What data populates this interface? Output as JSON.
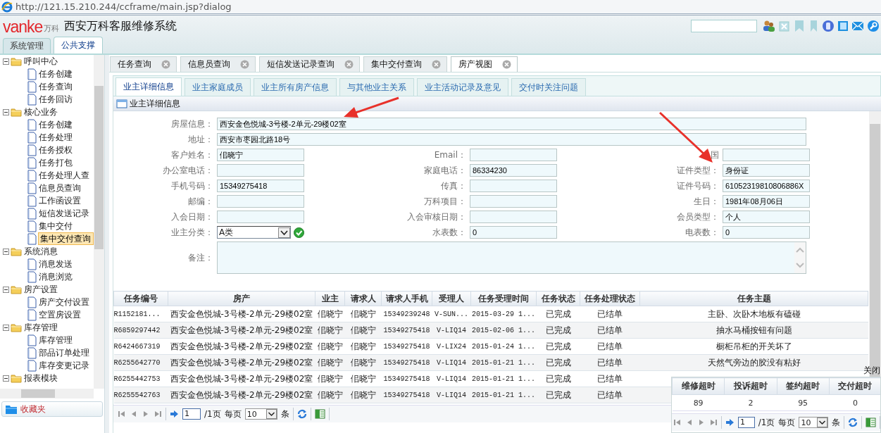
{
  "browser": {
    "url": "http://121.15.210.244/ccframe/main.jsp?dialog"
  },
  "header": {
    "logo": "vanke",
    "logo_cn": "万科",
    "title": "西安万科客服维修系统"
  },
  "module_tabs": [
    {
      "label": "系统管理",
      "selected": false
    },
    {
      "label": "公共支撑",
      "selected": true
    }
  ],
  "sidebar": {
    "tree": [
      {
        "label": "呼叫中心",
        "expanded": true,
        "children": [
          {
            "label": "任务创建",
            "selected": false
          },
          {
            "label": "任务查询",
            "selected": false
          },
          {
            "label": "任务回访",
            "selected": false
          }
        ]
      },
      {
        "label": "核心业务",
        "expanded": true,
        "children": [
          {
            "label": "任务创建",
            "selected": false
          },
          {
            "label": "任务处理",
            "selected": false
          },
          {
            "label": "任务授权",
            "selected": false
          },
          {
            "label": "任务打包",
            "selected": false
          },
          {
            "label": "任务处理人查",
            "selected": false
          },
          {
            "label": "信息员查询",
            "selected": false
          },
          {
            "label": "工作函设置",
            "selected": false
          },
          {
            "label": "短信发送记录",
            "selected": false
          },
          {
            "label": "集中交付",
            "selected": false
          },
          {
            "label": "集中交付查询",
            "selected": true
          }
        ]
      },
      {
        "label": "系统消息",
        "expanded": true,
        "children": [
          {
            "label": "消息发送",
            "selected": false
          },
          {
            "label": "消息浏览",
            "selected": false
          }
        ]
      },
      {
        "label": "房产设置",
        "expanded": true,
        "children": [
          {
            "label": "房产交付设置",
            "selected": false
          },
          {
            "label": "空置房设置",
            "selected": false
          }
        ]
      },
      {
        "label": "库存管理",
        "expanded": true,
        "children": [
          {
            "label": "库存管理",
            "selected": false
          },
          {
            "label": "部品订单处理",
            "selected": false
          },
          {
            "label": "库存变更记录",
            "selected": false
          }
        ]
      },
      {
        "label": "报表模块",
        "expanded": true
      }
    ],
    "favorites": "收藏夹"
  },
  "doc_tabs": [
    {
      "label": "任务查询",
      "selected": false
    },
    {
      "label": "信息员查询",
      "selected": false
    },
    {
      "label": "短信发送记录查询",
      "selected": false
    },
    {
      "label": "集中交付查询",
      "selected": false
    },
    {
      "label": "房产视图",
      "selected": true
    }
  ],
  "sub_tabs": [
    {
      "label": "业主详细信息",
      "selected": true
    },
    {
      "label": "业主家庭成员",
      "selected": false
    },
    {
      "label": "业主所有房产信息",
      "selected": false
    },
    {
      "label": "与其他业主关系",
      "selected": false
    },
    {
      "label": "业主活动记录及意见",
      "selected": false
    },
    {
      "label": "交付时关注问题",
      "selected": false
    }
  ],
  "panel": {
    "title": "业主详细信息",
    "wide_fields": [
      {
        "label": "房屋信息：",
        "value": "西安金色悦城-3号楼-2单元-29楼02室"
      },
      {
        "label": "地址：",
        "value": "西安市枣园北路18号"
      }
    ],
    "fields": [
      {
        "kind": "text",
        "label": "客户姓名：",
        "value": "佀晓宁"
      },
      {
        "kind": "text",
        "label": "Email："
      },
      {
        "kind": "text",
        "label": "国"
      },
      {
        "kind": "text",
        "label": "办公室电话："
      },
      {
        "kind": "text",
        "label": "家庭电话：",
        "value": "86334230"
      },
      {
        "kind": "text",
        "label": "证件类型：",
        "value": "身份证"
      },
      {
        "kind": "text",
        "label": "手机号码：",
        "value": "15349275418"
      },
      {
        "kind": "text",
        "label": "传真："
      },
      {
        "kind": "text",
        "label": "证件号码：",
        "value": "61052319810806886X"
      },
      {
        "kind": "text",
        "label": "邮编："
      },
      {
        "kind": "text",
        "label": "万科项目："
      },
      {
        "kind": "text",
        "label": "生日：",
        "value": "1981年08月06日"
      },
      {
        "kind": "text",
        "label": "入会日期："
      },
      {
        "kind": "text",
        "label": "入会审核日期："
      },
      {
        "kind": "text",
        "label": "会员类型：",
        "value": "个人"
      },
      {
        "kind": "select",
        "label": "业主分类：",
        "value": "A类"
      },
      {
        "kind": "text",
        "label": "水表数：",
        "value": "0"
      },
      {
        "kind": "text",
        "label": "电表数：",
        "value": "0"
      }
    ],
    "remark": {
      "label": "备注："
    }
  },
  "table": {
    "columns": [
      "任务编号",
      "房产",
      "业主",
      "请求人",
      "请求人手机",
      "受理人",
      "任务受理时间",
      "任务状态",
      "任务处理状态",
      "任务主题"
    ],
    "rows": [
      [
        "R1152181...",
        "西安金色悦城-3号楼-2单元-29楼02室",
        "佀晓宁",
        "佀晓宁",
        "15349239248",
        "V-SUN...",
        "2015-03-29 1...",
        "已完成",
        "已结单",
        "主卧、次卧木地板有磕碰"
      ],
      [
        "R6859297442",
        "西安金色悦城-3号楼-2单元-29楼02室",
        "佀晓宁",
        "佀晓宁",
        "15349275418",
        "V-LIQ14",
        "2015-02-06 1...",
        "已完成",
        "已结单",
        "抽水马桶按钮有问题"
      ],
      [
        "R6424667319",
        "西安金色悦城-3号楼-2单元-29楼02室",
        "佀晓宁",
        "佀晓宁",
        "15349275418",
        "V-LIX24",
        "2015-01-24 1...",
        "已完成",
        "已结单",
        "橱柜吊柜的开关坏了"
      ],
      [
        "R6255642770",
        "西安金色悦城-3号楼-2单元-29楼02室",
        "佀晓宁",
        "佀晓宁",
        "15349275418",
        "V-LIQ14",
        "2015-01-21 1...",
        "已完成",
        "已结单",
        "天然气旁边的胶没有粘好"
      ],
      [
        "R6255442753",
        "西安金色悦城-3号楼-2单元-29楼02室",
        "佀晓宁",
        "佀晓宁",
        "15349275418",
        "V-LIQ14",
        "2015-01-21 1...",
        "已完成",
        "已结单"
      ],
      [
        "R6255542763",
        "西安金色悦城-3号楼-2单元-29楼02室",
        "佀晓宁",
        "佀晓宁",
        "15349275418",
        "V-LIQ14",
        "2015-01-21 1...",
        "已完成",
        "已结单"
      ]
    ]
  },
  "pager": {
    "page": "1",
    "total": "/1页",
    "per_page_label": "每页",
    "per_page": "10",
    "unit": "条"
  },
  "popup": {
    "close": "关闭",
    "columns": [
      "维修超时",
      "投诉超时",
      "签约超时",
      "交付超时"
    ],
    "values": [
      "89",
      "2",
      "95",
      "0"
    ],
    "pager": {
      "page": "1",
      "total": "/1页",
      "per_page_label": "每页",
      "per_page": "10",
      "unit": "条"
    }
  }
}
